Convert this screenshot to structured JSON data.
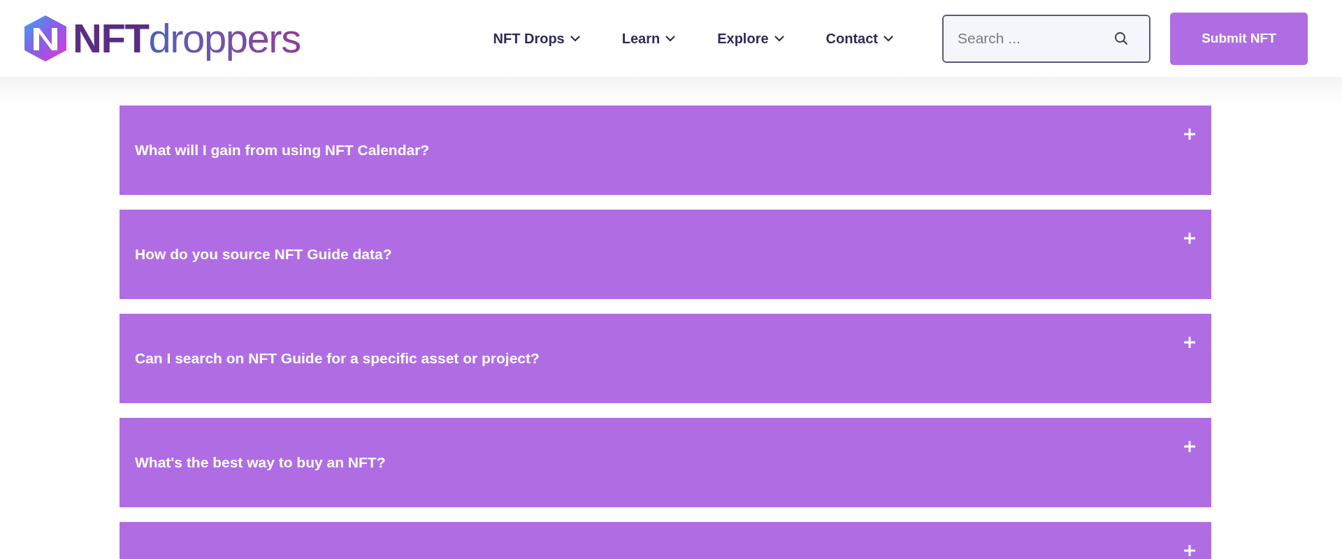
{
  "header": {
    "logo": {
      "word_1": "NFT",
      "word_2": "droppers"
    },
    "nav": [
      {
        "label": "NFT Drops"
      },
      {
        "label": "Learn"
      },
      {
        "label": "Explore"
      },
      {
        "label": "Contact"
      }
    ],
    "search": {
      "placeholder": "Search ..."
    },
    "submit_button": "Submit NFT"
  },
  "faq": [
    {
      "question": "What will I gain from using NFT Calendar?",
      "expanded": false
    },
    {
      "question": "How do you source NFT Guide data?",
      "expanded": false
    },
    {
      "question": "Can I search on NFT Guide for a specific asset or project?",
      "expanded": false
    },
    {
      "question": "What's the best way to buy an NFT?",
      "expanded": false
    },
    {
      "expanded": false
    }
  ]
}
